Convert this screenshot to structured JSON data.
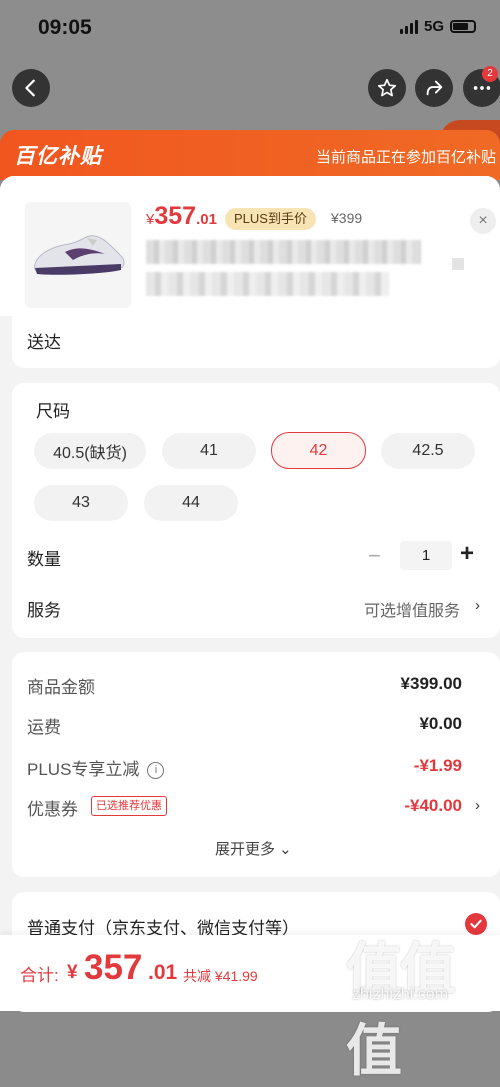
{
  "status_bar": {
    "time": "09:05",
    "network": "5G"
  },
  "nav": {
    "badge": "2"
  },
  "banner": {
    "logo": "百亿补贴",
    "text": "当前商品正在参加百亿补贴"
  },
  "product": {
    "price_symbol": "¥",
    "price_int": "357",
    "price_dec": ".01",
    "plus_tag": "PLUS到手价",
    "original_price": "¥399",
    "close": "×"
  },
  "delivery": {
    "text": "送达"
  },
  "spec": {
    "title": "尺码",
    "sizes": [
      "40.5(缺货)",
      "41",
      "42",
      "42.5",
      "43",
      "44"
    ],
    "selected_size": "42",
    "quantity_label": "数量",
    "quantity_minus": "−",
    "quantity_value": "1",
    "quantity_plus": "+",
    "service_label": "服务",
    "service_value": "可选增值服务",
    "chevron": "›"
  },
  "summary": {
    "rows": [
      {
        "label": "商品金额",
        "value": "¥399.00"
      },
      {
        "label": "运费",
        "value": "¥0.00"
      },
      {
        "label": "PLUS专享立减",
        "value": "-¥1.99"
      },
      {
        "label": "优惠券",
        "value": "-¥40.00"
      }
    ],
    "info_icon": "i",
    "coupon_tag": "已选推荐优惠",
    "expand": "展开更多 ⌄"
  },
  "payment": {
    "label": "普通支付（京东支付、微信支付等）"
  },
  "bottom": {
    "total_label": "合计:",
    "total_symbol": "¥",
    "total_int": "357",
    "total_dec": ".01",
    "saved": "共减 ¥41.99"
  },
  "watermark": {
    "text": "值值值",
    "url": "zhizhizhi.com"
  }
}
